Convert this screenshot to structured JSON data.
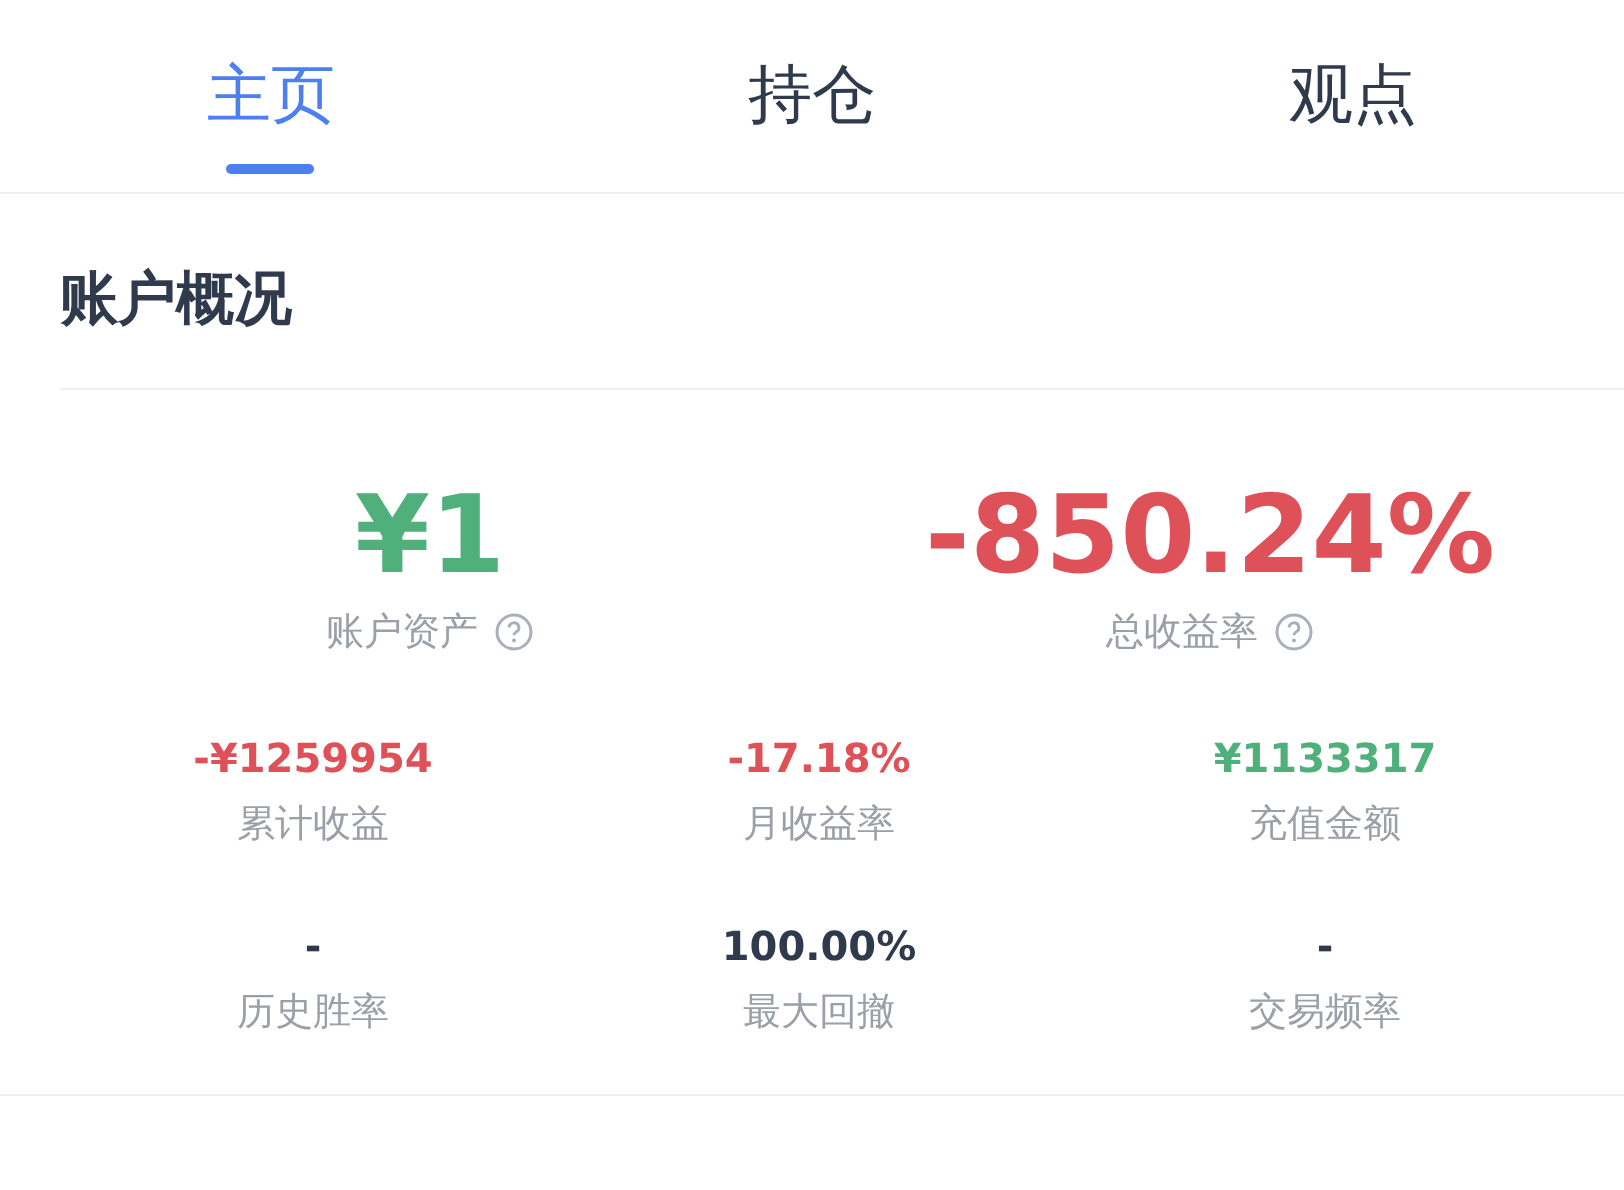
{
  "tabs": [
    {
      "label": "主页",
      "selected": true
    },
    {
      "label": "持仓",
      "selected": false
    },
    {
      "label": "观点",
      "selected": false
    }
  ],
  "section": {
    "title": "账户概况"
  },
  "headline": [
    {
      "value": "¥1",
      "label": "账户资产",
      "color": "#4fb07c"
    },
    {
      "value": "-850.24%",
      "label": "总收益率",
      "color": "#df5158"
    }
  ],
  "stats": [
    {
      "value": "-¥1259954",
      "label": "累计收益",
      "color": "#df5158"
    },
    {
      "value": "-17.18%",
      "label": "月收益率",
      "color": "#df5158"
    },
    {
      "value": "¥1133317",
      "label": "充值金额",
      "color": "#4fb07c"
    },
    {
      "value": "-",
      "label": "历史胜率",
      "color": "#2f3a4d"
    },
    {
      "value": "100.00%",
      "label": "最大回撤",
      "color": "#2f3a4d"
    },
    {
      "value": "-",
      "label": "交易频率",
      "color": "#2f3a4d"
    }
  ]
}
